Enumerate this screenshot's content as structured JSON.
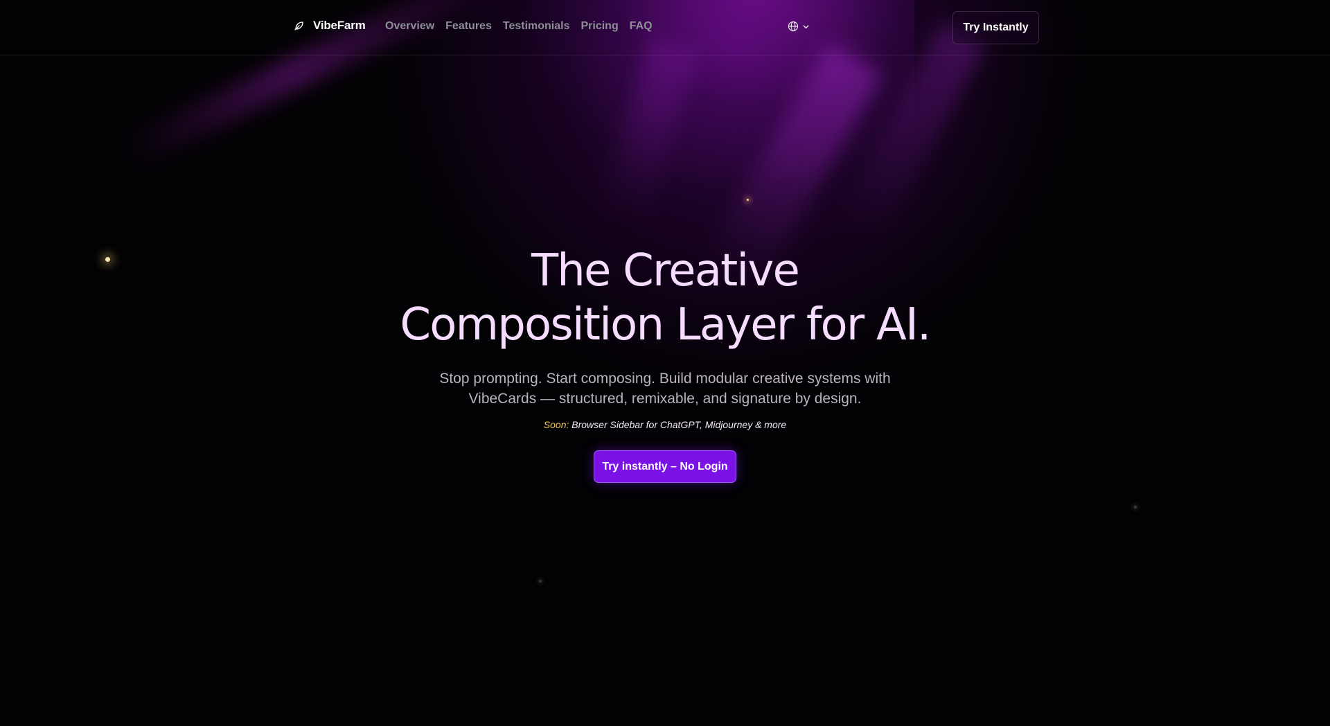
{
  "header": {
    "brand_name": "VibeFarm",
    "brand_icon": "leaf-icon",
    "nav": [
      {
        "label": "Overview"
      },
      {
        "label": "Features"
      },
      {
        "label": "Testimonials"
      },
      {
        "label": "Pricing"
      },
      {
        "label": "FAQ"
      }
    ],
    "language_icon": "globe-icon",
    "language_chevron_icon": "chevron-down-icon",
    "try_button": "Try Instantly"
  },
  "hero": {
    "title_line1": "The Creative",
    "title_line2": "Composition Layer for AI.",
    "subtitle": "Stop prompting. Start composing. Build modular creative systems with VibeCards — structured, remixable, and signature by design.",
    "soon_label": "Soon:",
    "soon_text": " Browser Sidebar for ChatGPT, Midjourney & more",
    "cta": "Try instantly – No Login"
  },
  "colors": {
    "background": "#020103",
    "accent": "#7a12e6",
    "title": "#f6dcff",
    "soon": "#f2c94c",
    "nav_text": "#8f8f98"
  }
}
